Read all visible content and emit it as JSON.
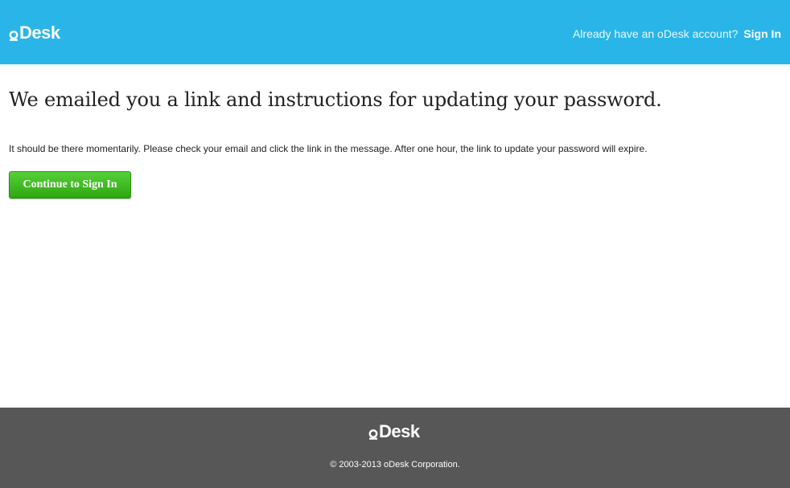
{
  "header": {
    "logo_text": "Desk",
    "prompt": "Already have an oDesk account?",
    "sign_in_label": "Sign In",
    "background": "#29b5e8"
  },
  "main": {
    "title": "We emailed you a link and instructions for updating your password.",
    "message": "It should be there momentarily. Please check your email and click the link in the message. After one hour, the link to update your password will expire.",
    "continue_label": "Continue to Sign In",
    "button_color": "#3dbb22"
  },
  "footer": {
    "logo_text": "Desk",
    "copyright": "© 2003-2013 oDesk Corporation.",
    "background": "#575757"
  },
  "icons": {
    "header_logo": "odesk-logo-icon",
    "footer_logo": "odesk-logo-icon"
  }
}
